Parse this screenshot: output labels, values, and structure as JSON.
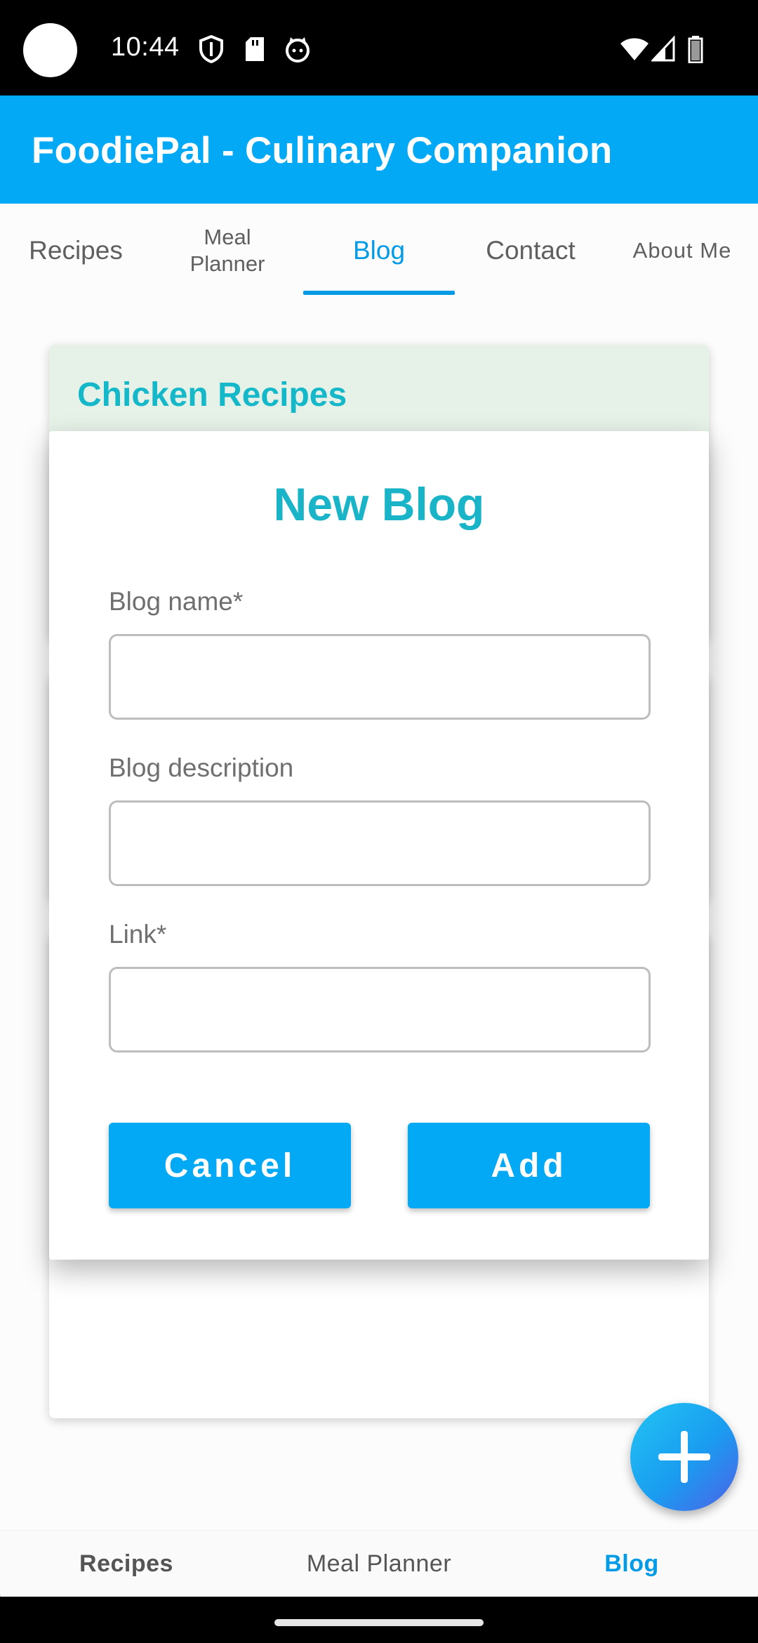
{
  "status_bar": {
    "time": "10:44",
    "icons": [
      "camera-cutout",
      "shield-icon",
      "sd-card-icon",
      "cat-icon",
      "wifi-icon",
      "signal-icon",
      "battery-icon"
    ]
  },
  "app_bar": {
    "title": "FoodiePal - Culinary Companion"
  },
  "tabs": [
    {
      "label": "Recipes",
      "active": false
    },
    {
      "label": "Meal Planner",
      "active": false
    },
    {
      "label": "Blog",
      "active": true
    },
    {
      "label": "Contact",
      "active": false
    },
    {
      "label": "About Me",
      "active": false
    }
  ],
  "cards": [
    {
      "title": "Chicken Recipes"
    }
  ],
  "dialog": {
    "title": "New Blog",
    "fields": [
      {
        "label": "Blog name*",
        "value": ""
      },
      {
        "label": "Blog description",
        "value": ""
      },
      {
        "label": "Link*",
        "value": ""
      }
    ],
    "cancel_label": "Cancel",
    "add_label": "Add"
  },
  "fab": {
    "icon": "plus-icon"
  },
  "bottom_nav": [
    {
      "label": "Recipes",
      "active": false
    },
    {
      "label": "Meal Planner",
      "active": false
    },
    {
      "label": "Blog",
      "active": true
    }
  ],
  "colors": {
    "primary": "#03a9f4",
    "accent_text": "#1ab4c8",
    "card_header": "#e6f1e8"
  }
}
